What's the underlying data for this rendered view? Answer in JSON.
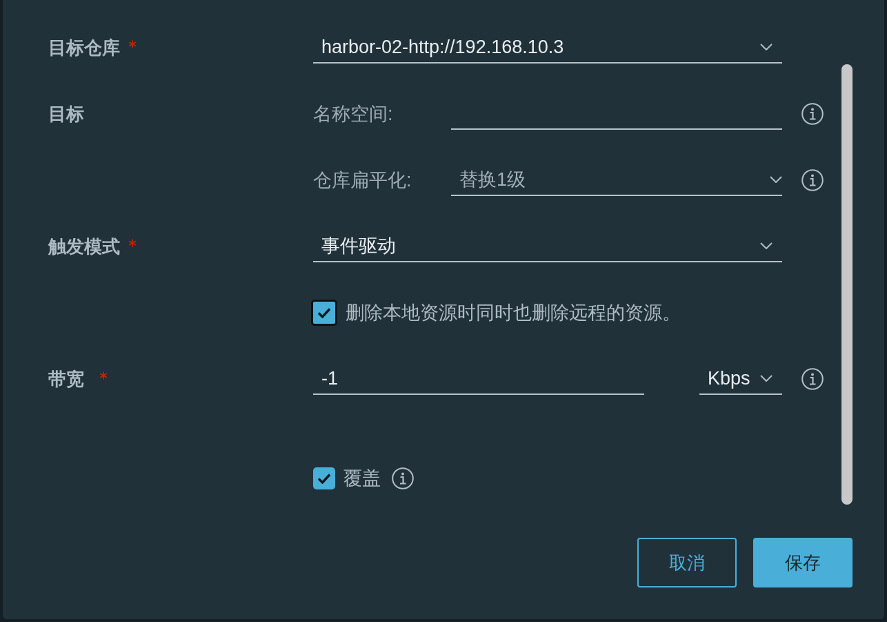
{
  "form": {
    "fields": [
      {
        "kind": "select",
        "label": "目标仓库",
        "required": true,
        "value": "harbor-02-http://192.168.10.3"
      },
      {
        "kind": "group",
        "label": "目标",
        "subfields": [
          {
            "kind": "input",
            "label": "名称空间:",
            "info": true
          },
          {
            "kind": "select",
            "label": "仓库扁平化:",
            "value": "替换1级",
            "info": true
          }
        ]
      },
      {
        "kind": "select",
        "label": "触发模式",
        "required": true,
        "value": "事件驱动"
      },
      {
        "kind": "checkbox",
        "label": "删除本地资源时同时也删除远程的资源。",
        "checked": true,
        "focused": true
      },
      {
        "kind": "bandwidth",
        "label": "带宽",
        "required": true,
        "value": "-1",
        "unit": "Kbps",
        "info": true
      },
      {
        "kind": "checkbox",
        "label": "覆盖",
        "checked": true,
        "info": true
      }
    ]
  },
  "footer": {
    "buttons": [
      {
        "kind": "outline",
        "label": "取消"
      },
      {
        "kind": "primary",
        "label": "保存"
      }
    ]
  }
}
